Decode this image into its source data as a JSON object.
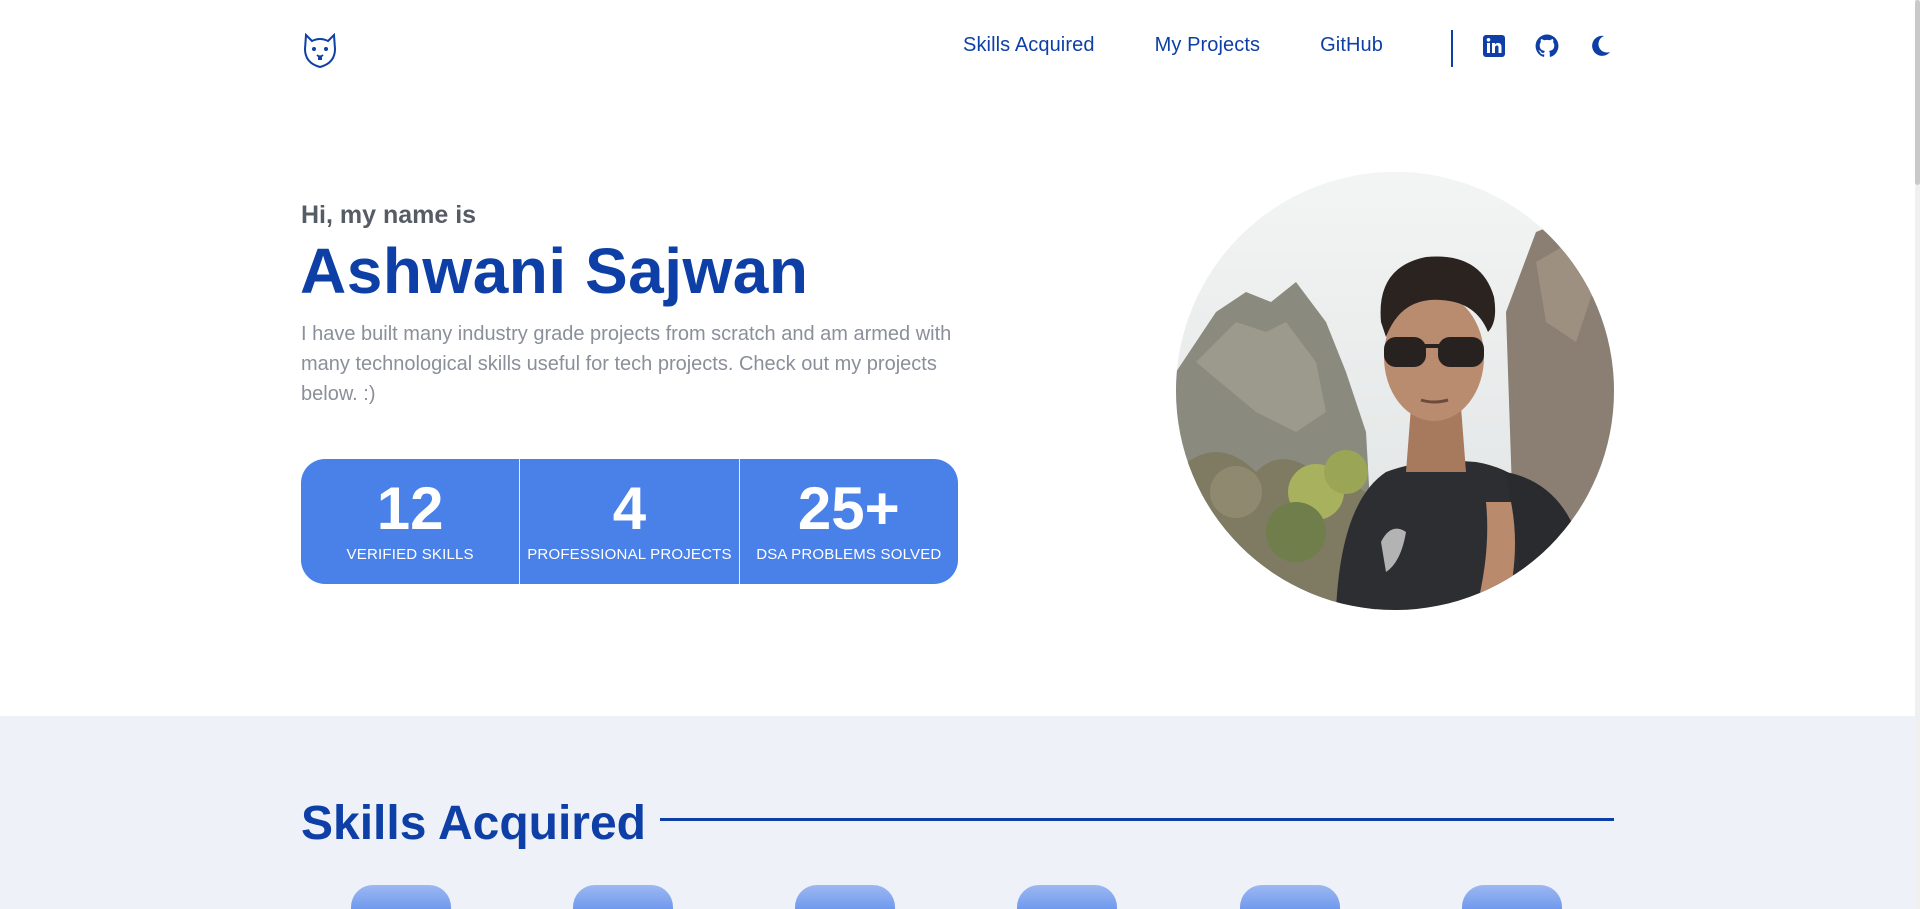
{
  "nav": {
    "links": [
      "Skills Acquired",
      "My Projects",
      "GitHub"
    ],
    "icons": [
      "linkedin-icon",
      "github-icon",
      "moon-icon"
    ]
  },
  "hero": {
    "greeting": "Hi, my name is",
    "name": "Ashwani Sajwan",
    "description": "I have built many industry grade projects from scratch and am armed with many technological skills useful for tech projects. Check out my projects below. :)",
    "stats": [
      {
        "value": "12",
        "label": "VERIFIED SKILLS"
      },
      {
        "value": "4",
        "label": "PROFESSIONAL PROJECTS"
      },
      {
        "value": "25+",
        "label": "DSA PROBLEMS SOLVED"
      }
    ]
  },
  "skills": {
    "title": "Skills Acquired"
  },
  "colors": {
    "primary": "#0d3fa6",
    "accent": "#4a81e8",
    "section_bg": "#eff1f8"
  }
}
